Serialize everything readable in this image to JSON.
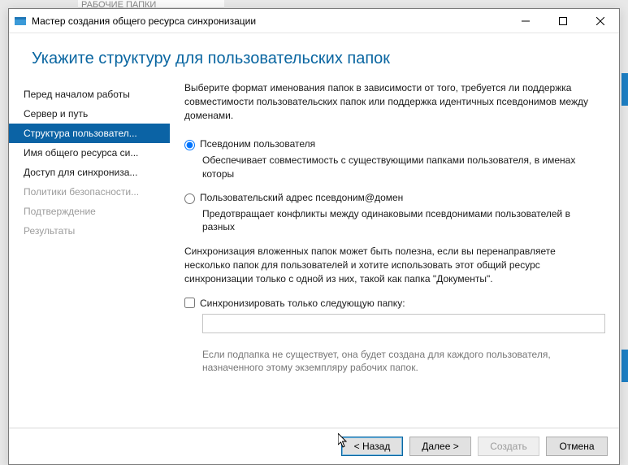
{
  "bg": {
    "tab_stub": "РАБОЧИЕ ПАПКИ"
  },
  "titlebar": {
    "title": "Мастер создания общего ресурса синхронизации"
  },
  "page_title": "Укажите структуру для пользовательских папок",
  "sidebar": {
    "items": [
      {
        "label": "Перед началом работы",
        "state": "normal"
      },
      {
        "label": "Сервер и путь",
        "state": "normal"
      },
      {
        "label": "Структура пользовател...",
        "state": "active"
      },
      {
        "label": "Имя общего ресурса си...",
        "state": "normal"
      },
      {
        "label": "Доступ для синхрониза...",
        "state": "normal"
      },
      {
        "label": "Политики безопасности...",
        "state": "disabled"
      },
      {
        "label": "Подтверждение",
        "state": "disabled"
      },
      {
        "label": "Результаты",
        "state": "disabled"
      }
    ]
  },
  "content": {
    "intro": "Выберите формат именования папок в зависимости от того, требуется ли поддержка совместимости пользовательских папок или поддержка идентичных псевдонимов между доменами.",
    "radio1_label": "Псевдоним пользователя",
    "radio1_desc": "Обеспечивает совместимость с существующими папками пользователя, в именах которы",
    "radio2_label": "Пользовательский адрес псевдоним@домен",
    "radio2_desc": "Предотвращает конфликты между одинаковыми псевдонимами пользователей в разных",
    "sync_text": "Синхронизация вложенных папок может быть полезна, если вы перенаправляете несколько папок для пользователей и хотите использовать этот общий ресурс синхронизации только с одной из них, такой как папка \"Документы\".",
    "checkbox_label": "Синхронизировать только следующую папку:",
    "folder_value": "",
    "hint": "Если подпапка не существует, она будет создана для каждого пользователя, назначенного этому экземпляру рабочих папок."
  },
  "footer": {
    "back": "< Назад",
    "next": "Далее >",
    "create": "Создать",
    "cancel": "Отмена"
  }
}
